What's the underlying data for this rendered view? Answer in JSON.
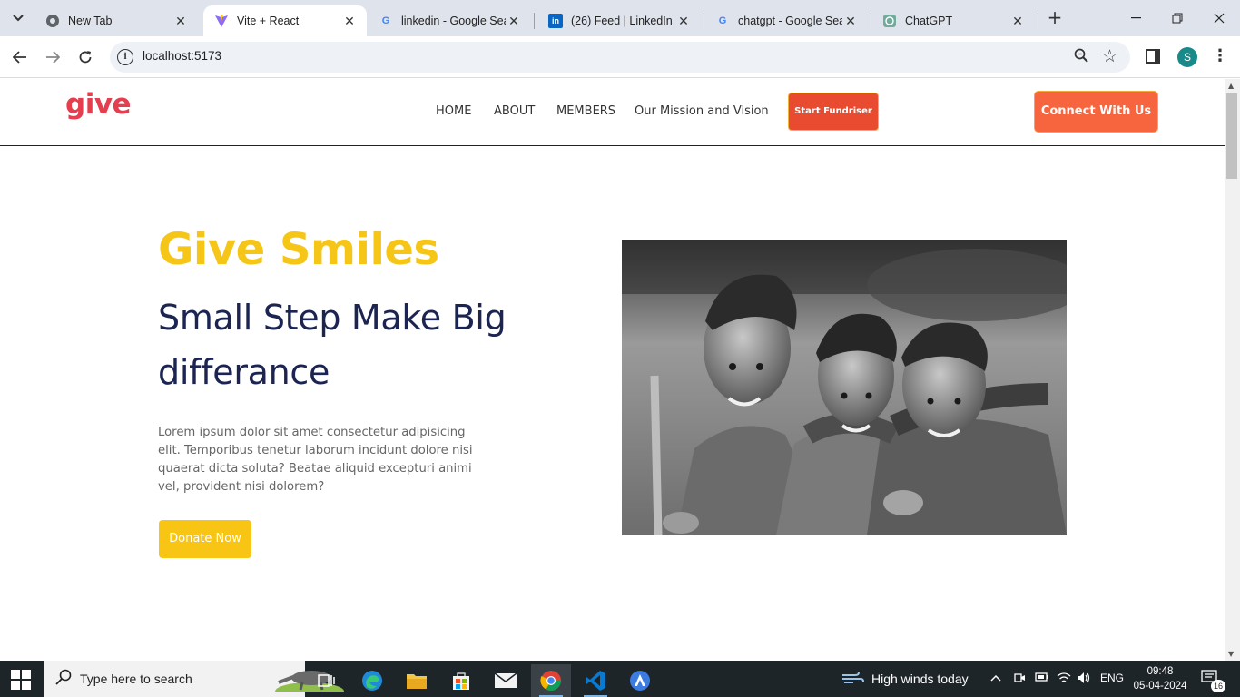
{
  "browser": {
    "tabs": [
      {
        "title": "New Tab",
        "icon": "chrome-icon",
        "active": false
      },
      {
        "title": "Vite + React",
        "icon": "vite-icon",
        "active": true
      },
      {
        "title": "linkedin - Google Sea",
        "icon": "google-icon",
        "active": false
      },
      {
        "title": "(26) Feed | LinkedIn",
        "icon": "linkedin-icon",
        "active": false
      },
      {
        "title": "chatgpt - Google Sea",
        "icon": "google-icon",
        "active": false
      },
      {
        "title": "ChatGPT",
        "icon": "chatgpt-icon",
        "active": false
      }
    ],
    "url": "localhost:5173",
    "profile_initial": "S",
    "colors": {
      "tabstrip": "#dfe3ec",
      "omnibox": "#eef1f6",
      "profile": "#188a8a"
    }
  },
  "site": {
    "logo": "give",
    "nav": {
      "home": "HOME",
      "about": "ABOUT",
      "members": "MEMBERS",
      "mission": "Our Mission and Vision",
      "fundraiser": "Start Fundriser",
      "connect": "Connect With Us"
    },
    "hero": {
      "title": "Give Smiles",
      "subtitle": "Small Step Make Big differance",
      "text": "Lorem ipsum dolor sit amet consectetur adipisicing elit. Temporibus tenetur laborum incidunt dolore nisi quaerat dicta soluta? Beatae aliquid excepturi animi vel, provident nisi dolorem?",
      "button": "Donate Now",
      "photo": "black-and-white photo of three smiling children"
    },
    "colors": {
      "logo": "#e53e4f",
      "title": "#f5c518",
      "subtitle": "#1c2452",
      "fundraiser": "#e84b2f",
      "connect": "#f7653f",
      "donate": "#f9c515"
    }
  },
  "taskbar": {
    "search_placeholder": "Type here to search",
    "weather": "High winds today",
    "language": "ENG",
    "time": "09:48",
    "date": "05-04-2024",
    "notifications": "16",
    "apps": [
      "task-view-icon",
      "edge-icon",
      "file-explorer-icon",
      "store-icon",
      "mail-icon",
      "chrome-icon",
      "vscode-icon",
      "app-icon"
    ]
  }
}
